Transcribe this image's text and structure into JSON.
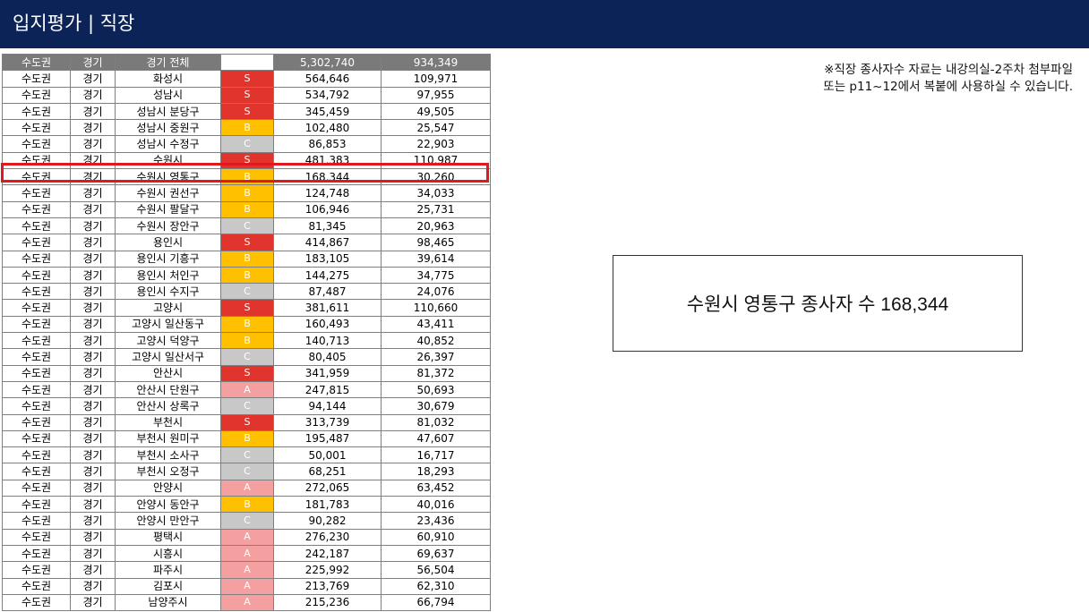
{
  "header": {
    "title": "입지평가 | 직장"
  },
  "grade_colors": {
    "S": "#e0342c",
    "A": "#f4a0a0",
    "B": "#ffc000",
    "C": "#c8c8c8"
  },
  "table": {
    "header_row": [
      "수도권",
      "경기",
      "경기 전체",
      "",
      "5,302,740",
      "934,349"
    ],
    "rows": [
      [
        "수도권",
        "경기",
        "화성시",
        "S",
        "564,646",
        "109,971"
      ],
      [
        "수도권",
        "경기",
        "성남시",
        "S",
        "534,792",
        "97,955"
      ],
      [
        "수도권",
        "경기",
        "성남시 분당구",
        "S",
        "345,459",
        "49,505"
      ],
      [
        "수도권",
        "경기",
        "성남시 중원구",
        "B",
        "102,480",
        "25,547"
      ],
      [
        "수도권",
        "경기",
        "성남시 수정구",
        "C",
        "86,853",
        "22,903"
      ],
      [
        "수도권",
        "경기",
        "수원시",
        "S",
        "481,383",
        "110,987"
      ],
      [
        "수도권",
        "경기",
        "수원시 영통구",
        "B",
        "168,344",
        "30,260"
      ],
      [
        "수도권",
        "경기",
        "수원시 권선구",
        "B",
        "124,748",
        "34,033"
      ],
      [
        "수도권",
        "경기",
        "수원시 팔달구",
        "B",
        "106,946",
        "25,731"
      ],
      [
        "수도권",
        "경기",
        "수원시 장안구",
        "C",
        "81,345",
        "20,963"
      ],
      [
        "수도권",
        "경기",
        "용인시",
        "S",
        "414,867",
        "98,465"
      ],
      [
        "수도권",
        "경기",
        "용인시 기흥구",
        "B",
        "183,105",
        "39,614"
      ],
      [
        "수도권",
        "경기",
        "용인시 처인구",
        "B",
        "144,275",
        "34,775"
      ],
      [
        "수도권",
        "경기",
        "용인시 수지구",
        "C",
        "87,487",
        "24,076"
      ],
      [
        "수도권",
        "경기",
        "고양시",
        "S",
        "381,611",
        "110,660"
      ],
      [
        "수도권",
        "경기",
        "고양시 일산동구",
        "B",
        "160,493",
        "43,411"
      ],
      [
        "수도권",
        "경기",
        "고양시 덕양구",
        "B",
        "140,713",
        "40,852"
      ],
      [
        "수도권",
        "경기",
        "고양시 일산서구",
        "C",
        "80,405",
        "26,397"
      ],
      [
        "수도권",
        "경기",
        "안산시",
        "S",
        "341,959",
        "81,372"
      ],
      [
        "수도권",
        "경기",
        "안산시 단원구",
        "A",
        "247,815",
        "50,693"
      ],
      [
        "수도권",
        "경기",
        "안산시 상록구",
        "C",
        "94,144",
        "30,679"
      ],
      [
        "수도권",
        "경기",
        "부천시",
        "S",
        "313,739",
        "81,032"
      ],
      [
        "수도권",
        "경기",
        "부천시 원미구",
        "B",
        "195,487",
        "47,607"
      ],
      [
        "수도권",
        "경기",
        "부천시 소사구",
        "C",
        "50,001",
        "16,717"
      ],
      [
        "수도권",
        "경기",
        "부천시 오정구",
        "C",
        "68,251",
        "18,293"
      ],
      [
        "수도권",
        "경기",
        "안양시",
        "A",
        "272,065",
        "63,452"
      ],
      [
        "수도권",
        "경기",
        "안양시 동안구",
        "B",
        "181,783",
        "40,016"
      ],
      [
        "수도권",
        "경기",
        "안양시 만안구",
        "C",
        "90,282",
        "23,436"
      ],
      [
        "수도권",
        "경기",
        "평택시",
        "A",
        "276,230",
        "60,910"
      ],
      [
        "수도권",
        "경기",
        "시흥시",
        "A",
        "242,187",
        "69,637"
      ],
      [
        "수도권",
        "경기",
        "파주시",
        "A",
        "225,992",
        "56,504"
      ],
      [
        "수도권",
        "경기",
        "김포시",
        "A",
        "213,769",
        "62,310"
      ],
      [
        "수도권",
        "경기",
        "남양주시",
        "A",
        "215,236",
        "66,794"
      ]
    ]
  },
  "note": {
    "line1": "※직장 종사자수 자료는 내강의실-2주차 첨부파일",
    "line2": "또는 p11~12에서 복붙에 사용하실 수 있습니다."
  },
  "callout": {
    "text": "수원시 영통구 종사자 수 168,344"
  }
}
